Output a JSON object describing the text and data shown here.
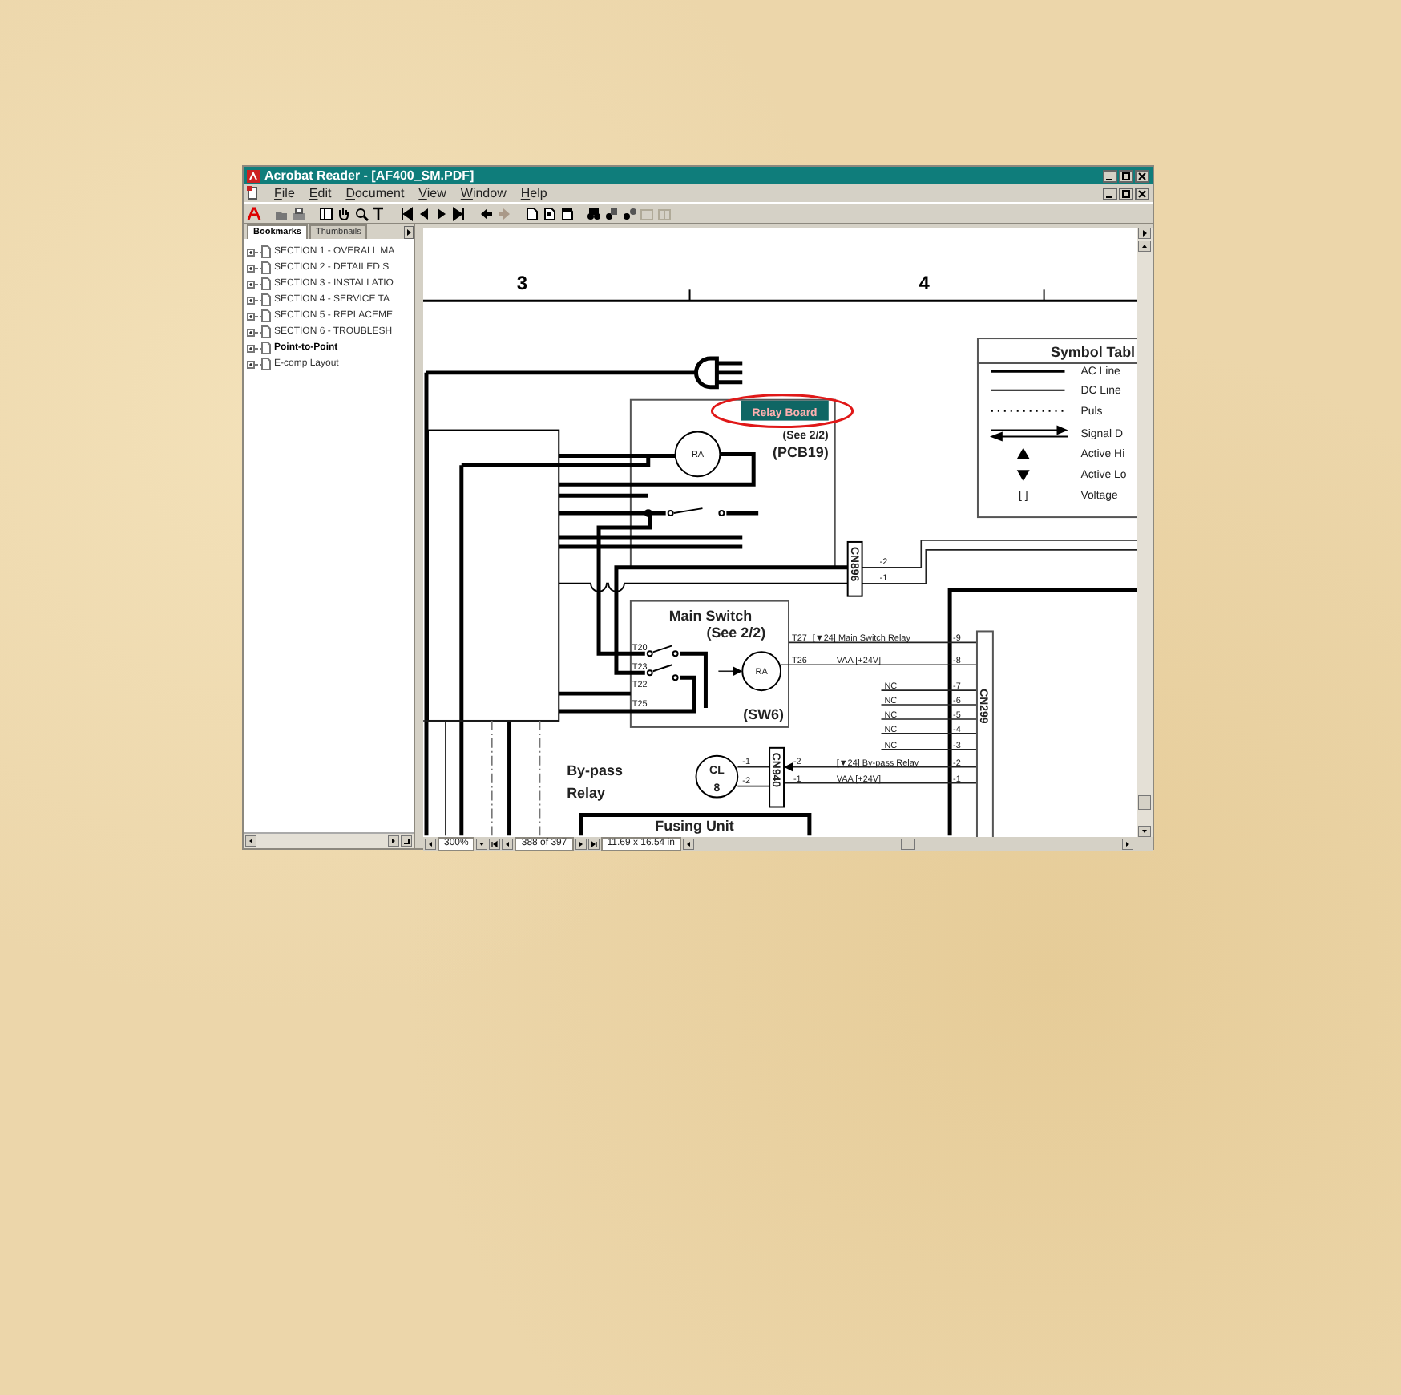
{
  "window": {
    "title": "Acrobat Reader - [AF400_SM.PDF]"
  },
  "menu": [
    "File",
    "Edit",
    "Document",
    "View",
    "Window",
    "Help"
  ],
  "sidebar": {
    "tabs": [
      {
        "label": "Bookmarks",
        "selected": true
      },
      {
        "label": "Thumbnails",
        "selected": false
      }
    ],
    "items": [
      {
        "label": "SECTION 1 - OVERALL MA",
        "bold": false
      },
      {
        "label": "SECTION 2 - DETAILED S",
        "bold": false
      },
      {
        "label": "SECTION 3 - INSTALLATIO",
        "bold": false
      },
      {
        "label": "SECTION 4 - SERVICE TA",
        "bold": false
      },
      {
        "label": "SECTION 5 - REPLACEME",
        "bold": false
      },
      {
        "label": "SECTION 6 - TROUBLESH",
        "bold": false
      },
      {
        "label": "Point-to-Point",
        "bold": true
      },
      {
        "label": "E-comp Layout",
        "bold": false
      }
    ]
  },
  "diagram": {
    "column_markers": [
      "3",
      "4"
    ],
    "symbol_table": {
      "title": "Symbol Tabl",
      "rows": [
        {
          "kind": "ac",
          "label": "AC Line"
        },
        {
          "kind": "dc",
          "label": "DC Line"
        },
        {
          "kind": "pulse",
          "label": "Puls"
        },
        {
          "kind": "signal",
          "label": "Signal D"
        },
        {
          "kind": "active_high",
          "label": "Active Hi"
        },
        {
          "kind": "active_low",
          "label": "Active Lo"
        },
        {
          "kind": "voltage",
          "label": "Voltage",
          "symbol": "[ ]"
        }
      ]
    },
    "relay_board": {
      "name": "Relay Board",
      "ref": "(See 2/2)",
      "id": "(PCB19)",
      "coil": "RA"
    },
    "cn896": {
      "label": "CN896",
      "pins": [
        "-2",
        "-1"
      ]
    },
    "main_switch": {
      "name": "Main Switch",
      "ref": "(See 2/2)",
      "id": "(SW6)",
      "coil": "RA",
      "terminals": [
        "T20",
        "T23",
        "T22",
        "T25"
      ]
    },
    "cn299": {
      "label": "CN299",
      "pins": [
        {
          "pin": "-9",
          "terminal": "T27",
          "signal": "[▼24] Main Switch Relay"
        },
        {
          "pin": "-8",
          "terminal": "T26",
          "signal": "VAA [+24V]"
        },
        {
          "pin": "-7",
          "signal": "NC"
        },
        {
          "pin": "-6",
          "signal": "NC"
        },
        {
          "pin": "-5",
          "signal": "NC"
        },
        {
          "pin": "-4",
          "signal": "NC"
        },
        {
          "pin": "-3",
          "signal": "NC"
        },
        {
          "pin": "-2",
          "signal": "[▼24] By-pass Relay"
        },
        {
          "pin": "-1",
          "signal": "VAA [+24V]"
        }
      ]
    },
    "bypass_relay": {
      "name": [
        "By-pass",
        "Relay"
      ],
      "coil": [
        "CL",
        "8"
      ],
      "coil_pins": [
        "-1",
        "-2"
      ]
    },
    "cn940": {
      "label": "CN940",
      "pins": [
        "-2",
        "-1"
      ]
    },
    "fusing_unit": {
      "name": "Fusing Unit"
    }
  },
  "status_bar": {
    "zoom": "300%",
    "page": "388 of 397",
    "size": "11.69 x 16.54 in"
  }
}
